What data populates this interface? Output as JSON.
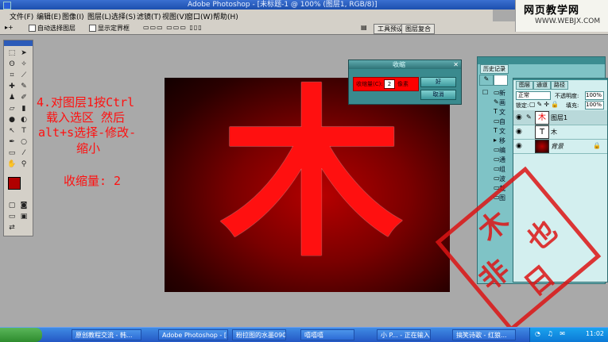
{
  "app": {
    "title": "Adobe Photoshop - [未标题-1 @ 100% (图层1, RGB/8)]"
  },
  "menu": [
    "文件(F)",
    "编辑(E)",
    "图像(I)",
    "图层(L)",
    "选择(S)",
    "滤镜(T)",
    "视图(V)",
    "窗口(W)",
    "帮助(H)"
  ],
  "options_bar": {
    "auto_select": "自动选择图层",
    "show_bounds": "显示定界框",
    "tab1": "工具预设",
    "tab2": "图层复合"
  },
  "watermark": {
    "title": "网页教学网",
    "url": "WWW.WEBJX.COM"
  },
  "tutorial": {
    "line1": "4.对图层1按Ctrl",
    "line2": "载入选区  然后",
    "line3": "alt+s选择-修改-",
    "line4": "缩小",
    "line5": "收缩量: 2"
  },
  "canvas": {
    "glyph": "木"
  },
  "dialog": {
    "title": "收缩",
    "label": "收缩量(C):",
    "value": "2",
    "unit": "像素",
    "ok": "好",
    "cancel": "取消"
  },
  "history": {
    "tab": "历史记录",
    "items": [
      "新",
      "画",
      "文",
      "自",
      "文",
      "移",
      "编",
      "通",
      "组",
      "波",
      "载",
      "图"
    ]
  },
  "layers": {
    "tabs": [
      "图层",
      "通道",
      "路径"
    ],
    "blend_mode": "正常",
    "opacity_label": "不透明度:",
    "opacity": "100%",
    "lock_label": "锁定:",
    "fill_label": "填充:",
    "fill": "100%",
    "rows": [
      {
        "name": "图层1",
        "thumb": "木"
      },
      {
        "name": "木",
        "thumb": "T"
      },
      {
        "name": "背景",
        "thumb": ""
      }
    ]
  },
  "stamp": {
    "chars": [
      "木",
      "非",
      "也",
      "日"
    ]
  },
  "taskbar": {
    "buttons": [
      "原创教程交流 - 韩...",
      "Adobe Photoshop - [...",
      "粉拉图的水墨0909...",
      "嘻嘻嘻",
      "小 P... - 正在输入",
      "搞笑诗歌 - 红狼..."
    ],
    "clock": "11:02"
  }
}
